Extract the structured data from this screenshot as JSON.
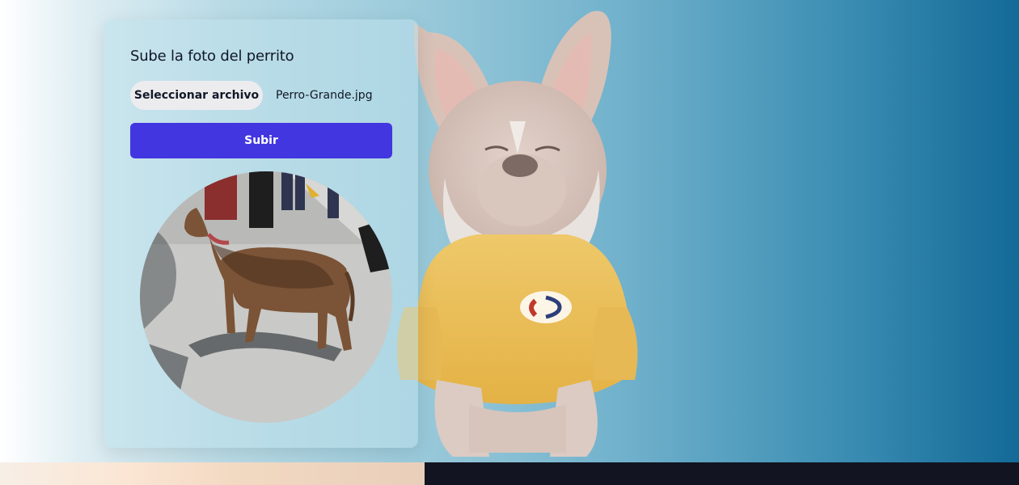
{
  "upload_card": {
    "title": "Sube la foto del perrito",
    "file_button_label": "Seleccionar archivo",
    "selected_file_name": "Perro-Grande.jpg",
    "submit_label": "Subir"
  },
  "colors": {
    "submit_button": "#4236e0",
    "file_button": "#ececee",
    "bottom_strip_dark": "#121521"
  }
}
